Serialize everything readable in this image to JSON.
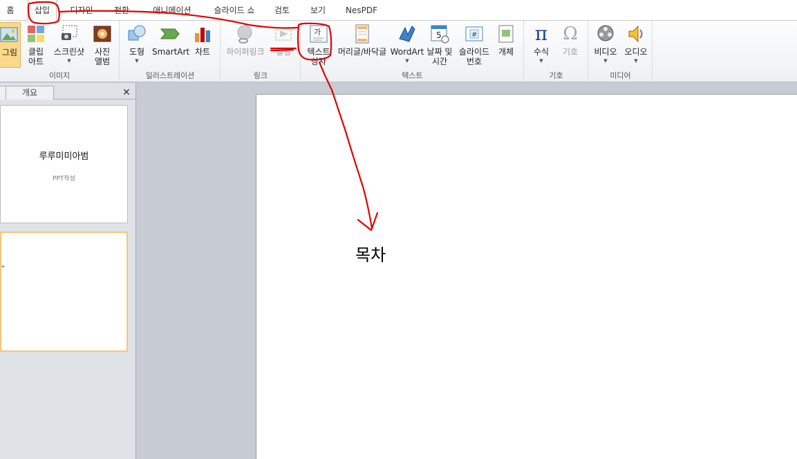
{
  "tabs": [
    "홈",
    "삽입",
    "디자인",
    "전환",
    "애니메이션",
    "슬라이드 쇼",
    "검토",
    "보기",
    "NesPDF"
  ],
  "ribbon": {
    "groups": {
      "image": "이미지",
      "illustration": "일러스트레이션",
      "link": "링크",
      "text": "텍스트",
      "symbol": "기호",
      "media": "미디어"
    },
    "buttons": {
      "picture": "그림",
      "clipart": [
        "클립",
        "아트"
      ],
      "screenshot": "스크린샷",
      "photo_album": [
        "사진",
        "앨범"
      ],
      "shapes": "도형",
      "smartart": "SmartArt",
      "chart": "차트",
      "hyperlink": "하이퍼링크",
      "action": "실행",
      "textbox": [
        "텍스트",
        "상자"
      ],
      "header_footer": "머리글/바닥글",
      "wordart": "WordArt",
      "datetime": [
        "날짜 및",
        "시간"
      ],
      "slide_number": [
        "슬라이드",
        "번호"
      ],
      "object": "개체",
      "equation": "수식",
      "symbol": "기호",
      "video": "비디오",
      "audio": "오디오"
    },
    "icon_glyphs": {
      "textbox": "가",
      "slide_number": "#",
      "calendar_day": "5",
      "equation": "π",
      "symbol": "Ω"
    }
  },
  "panel": {
    "tab_outline": "개요",
    "close": "✕",
    "slide1": {
      "title": "루루미미아범",
      "subtitle": "PPT작성"
    },
    "slide2_mark": "+"
  },
  "slide": {
    "text": "목차"
  },
  "annotation_color": "#e00000"
}
